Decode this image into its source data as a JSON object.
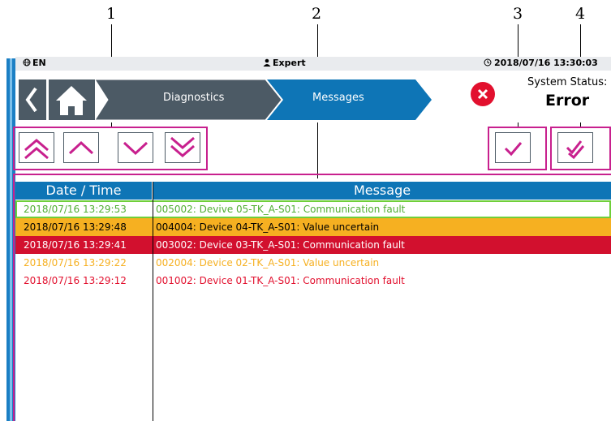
{
  "callouts": [
    "1",
    "2",
    "3",
    "4"
  ],
  "status_bar": {
    "language": "EN",
    "user": "Expert",
    "datetime": "2018/07/16 13:30:03"
  },
  "nav": {
    "back_icon": "chevron-left-icon",
    "home_icon": "home-icon",
    "breadcrumbs": [
      "Diagnostics",
      "Messages"
    ]
  },
  "system_status": {
    "label": "System Status:",
    "value": "Error",
    "icon": "error-x-icon",
    "color": "#e2102e"
  },
  "toolbar": {
    "nav_buttons": [
      "scroll-top-icon",
      "scroll-up-icon",
      "scroll-down-icon",
      "scroll-bottom-icon"
    ],
    "ack_buttons": [
      "acknowledge-icon",
      "acknowledge-all-icon"
    ]
  },
  "table": {
    "headers": [
      "Date / Time",
      "Message"
    ],
    "rows": [
      {
        "datetime": "2018/07/16 13:29:53",
        "message": "005002: Devive 05-TK_A-S01: Communication fault",
        "text_color": "#4fae32",
        "bg": "#ffffff",
        "selected": true
      },
      {
        "datetime": "2018/07/16 13:29:48",
        "message": "004004: Device 04-TK_A-S01: Value uncertain",
        "text_color": "#000000",
        "bg": "#f6b021",
        "selected": false
      },
      {
        "datetime": "2018/07/16 13:29:41",
        "message": "003002: Device 03-TK_A-S01: Communication fault",
        "text_color": "#ffffff",
        "bg": "#d2102e",
        "selected": false
      },
      {
        "datetime": "2018/07/16 13:29:22",
        "message": "002004: Device 02-TK_A-S01: Value uncertain",
        "text_color": "#f6b021",
        "bg": "#ffffff",
        "selected": false
      },
      {
        "datetime": "2018/07/16 13:29:12",
        "message": "001002: Device 01-TK_A-S01: Communication fault",
        "text_color": "#e2102e",
        "bg": "#ffffff",
        "selected": false
      }
    ]
  },
  "colors": {
    "accent_blue": "#0e75b6",
    "nav_dark": "#4c5a65",
    "highlight_magenta": "#c8208e"
  }
}
